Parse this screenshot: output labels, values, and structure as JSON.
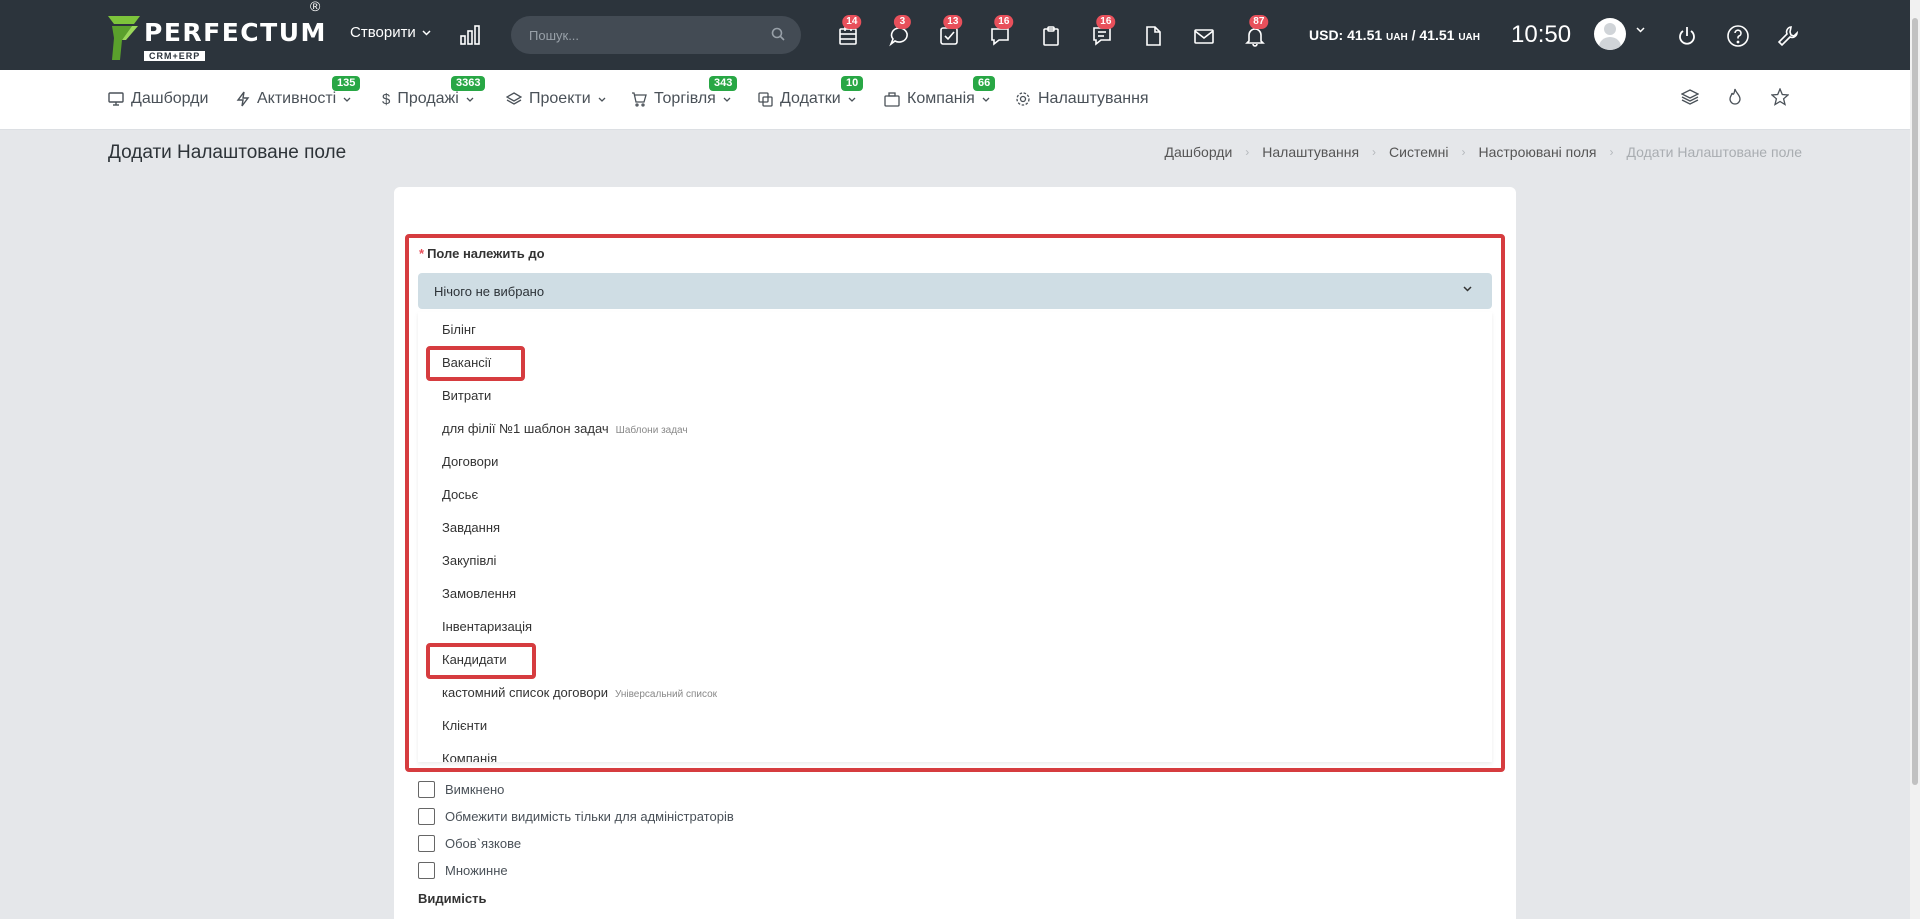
{
  "header": {
    "logo_name": "PERFECTUM",
    "logo_sub": "CRM+ERP",
    "logo_reg": "®",
    "create_label": "Створити",
    "search_placeholder": "Пошук...",
    "badges": {
      "calendar": "14",
      "chat": "3",
      "tasks": "13",
      "messages": "16",
      "notes": "16",
      "bell": "87"
    },
    "currency": "USD: 41.51",
    "currency_unit1": "UAH",
    "currency_sep": " / 41.51",
    "currency_unit2": "UAH",
    "clock": "10:50"
  },
  "nav": {
    "dashboards": "Дашборди",
    "activities": "Активності",
    "activities_badge": "135",
    "sales": "Продажі",
    "sales_badge": "3363",
    "projects": "Проекти",
    "trade": "Торгівля",
    "trade_badge": "343",
    "addons": "Додатки",
    "addons_badge": "10",
    "company": "Компанія",
    "company_badge": "66",
    "settings": "Налаштування"
  },
  "page": {
    "title": "Додати Налаштоване поле",
    "breadcrumb": [
      "Дашборди",
      "Налаштування",
      "Системні",
      "Настроювані поля",
      "Додати Налаштоване поле"
    ]
  },
  "form": {
    "required_mark": "*",
    "field_label": "Поле належить до",
    "select_value": "Нічого не вибрано",
    "options": [
      {
        "label": "Білінг",
        "sub": ""
      },
      {
        "label": "Вакансії",
        "sub": ""
      },
      {
        "label": "Витрати",
        "sub": ""
      },
      {
        "label": "для філії №1 шаблон задач",
        "sub": "Шаблони задач"
      },
      {
        "label": "Договори",
        "sub": ""
      },
      {
        "label": "Досьє",
        "sub": ""
      },
      {
        "label": "Завдання",
        "sub": ""
      },
      {
        "label": "Закупівлі",
        "sub": ""
      },
      {
        "label": "Замовлення",
        "sub": ""
      },
      {
        "label": "Інвентаризація",
        "sub": ""
      },
      {
        "label": "Кандидати",
        "sub": ""
      },
      {
        "label": "кастомний список договори",
        "sub": "Універсальний список"
      },
      {
        "label": "Клієнти",
        "sub": ""
      },
      {
        "label": "Компанія",
        "sub": ""
      }
    ],
    "checkboxes": [
      "Вимкнено",
      "Обмежити видимість тільки для адміністраторів",
      "Обов`язкове",
      "Множинне"
    ],
    "visibility_label": "Видимість"
  },
  "colors": {
    "topbar": "#2c343c",
    "badge_red": "#e8505b",
    "badge_green": "#28a745",
    "highlight": "#d63c3f",
    "select_bg": "#cfdde4"
  }
}
